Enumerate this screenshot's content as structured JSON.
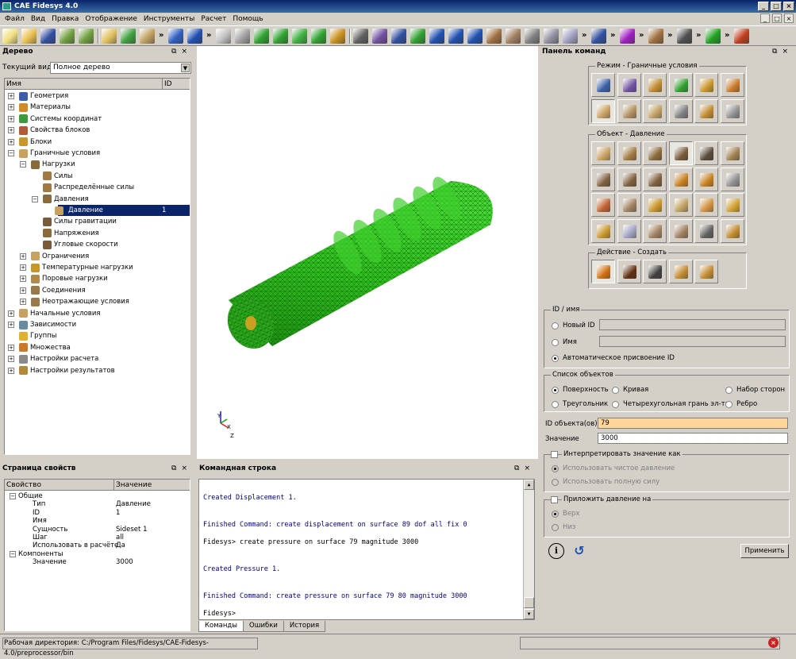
{
  "window": {
    "title": "CAE Fidesys 4.0",
    "min": "_",
    "max": "□",
    "close": "×"
  },
  "menu": [
    "Файл",
    "Вид",
    "Правка",
    "Отображение",
    "Инструменты",
    "Расчет",
    "Помощь"
  ],
  "tree_panel": {
    "title": "Дерево",
    "view_label": "Текущий вид",
    "view_value": "Полное дерево",
    "col_name": "Имя",
    "col_id": "ID",
    "selected_id": "1",
    "nodes": [
      {
        "label": "Геометрия",
        "level": 0,
        "exp": "+",
        "color": "#3a5fa8"
      },
      {
        "label": "Материалы",
        "level": 0,
        "exp": "+",
        "color": "#d08a2a"
      },
      {
        "label": "Системы координат",
        "level": 0,
        "exp": "+",
        "color": "#3c9a3c"
      },
      {
        "label": "Свойства блоков",
        "level": 0,
        "exp": "+",
        "color": "#b05a3a"
      },
      {
        "label": "Блоки",
        "level": 0,
        "exp": "+",
        "color": "#c8962a"
      },
      {
        "label": "Граничные условия",
        "level": 0,
        "exp": "-",
        "color": "#c8a060"
      },
      {
        "label": "Нагрузки",
        "level": 1,
        "exp": "-",
        "color": "#8a6a3a"
      },
      {
        "label": "Силы",
        "level": 2,
        "exp": "",
        "color": "#a07a40"
      },
      {
        "label": "Распределённые силы",
        "level": 2,
        "exp": "",
        "color": "#a07a40"
      },
      {
        "label": "Давления",
        "level": 2,
        "exp": "-",
        "color": "#8a6a3a"
      },
      {
        "label": "Давление",
        "level": 3,
        "exp": "",
        "color": "#c8a060",
        "selected": true
      },
      {
        "label": "Силы гравитации",
        "level": 2,
        "exp": "",
        "color": "#7a5a3a"
      },
      {
        "label": "Напряжения",
        "level": 2,
        "exp": "",
        "color": "#8a6a3a"
      },
      {
        "label": "Угловые скорости",
        "level": 2,
        "exp": "",
        "color": "#7a5a3a"
      },
      {
        "label": "Ограничения",
        "level": 1,
        "exp": "+",
        "color": "#c8a060"
      },
      {
        "label": "Температурные нагрузки",
        "level": 1,
        "exp": "+",
        "color": "#c8962a"
      },
      {
        "label": "Поровые нагрузки",
        "level": 1,
        "exp": "+",
        "color": "#b08a4a"
      },
      {
        "label": "Соединения",
        "level": 1,
        "exp": "+",
        "color": "#9a7a4a"
      },
      {
        "label": "Неотражающие условия",
        "level": 1,
        "exp": "+",
        "color": "#9a7a4a"
      },
      {
        "label": "Начальные условия",
        "level": 0,
        "exp": "+",
        "color": "#c8a060"
      },
      {
        "label": "Зависимости",
        "level": 0,
        "exp": "+",
        "color": "#6a8aa0"
      },
      {
        "label": "Группы",
        "level": 0,
        "exp": "",
        "color": "#e0b030"
      },
      {
        "label": "Множества",
        "level": 0,
        "exp": "+",
        "color": "#c87a2a"
      },
      {
        "label": "Настройки расчета",
        "level": 0,
        "exp": "+",
        "color": "#8a8a8a"
      },
      {
        "label": "Настройки результатов",
        "level": 0,
        "exp": "+",
        "color": "#b08a3a"
      }
    ]
  },
  "props_panel": {
    "title": "Страница свойств",
    "col_prop": "Свойство",
    "col_val": "Значение",
    "rows": [
      {
        "prop": "Общие",
        "val": "",
        "level": 0,
        "exp": "-"
      },
      {
        "prop": "Тип",
        "val": "Давление",
        "level": 1
      },
      {
        "prop": "ID",
        "val": "1",
        "level": 1
      },
      {
        "prop": "Имя",
        "val": "",
        "level": 1
      },
      {
        "prop": "Сущность",
        "val": "Sideset 1",
        "level": 1
      },
      {
        "prop": "Шаг",
        "val": "all",
        "level": 1
      },
      {
        "prop": "Использовать в расчёте",
        "val": "Да",
        "level": 1
      },
      {
        "prop": "Компоненты",
        "val": "",
        "level": 0,
        "exp": "-"
      },
      {
        "prop": "Значение",
        "val": "3000",
        "level": 1
      }
    ]
  },
  "viewport": {
    "axis_x": "X",
    "axis_y": "Y",
    "axis_z": "Z"
  },
  "cmd_panel": {
    "title": "Командная строка",
    "lines": [
      {
        "text": "Created Displacement 1.",
        "color": "blue"
      },
      {
        "text": "Finished Command: create displacement on surface 89 dof all fix 0",
        "color": "blue"
      },
      {
        "text": "Fidesys> create pressure on surface 79 magnitude 3000",
        "color": "black"
      },
      {
        "text": "Created Pressure 1.",
        "color": "blue"
      },
      {
        "text": "Finished Command: create pressure on surface 79 80 magnitude 3000",
        "color": "blue"
      },
      {
        "text": "Fidesys>",
        "color": "black"
      }
    ],
    "tabs": [
      "Команды",
      "Ошибки",
      "История"
    ]
  },
  "command_panel": {
    "title": "Панель команд",
    "mode_label": "Режим - Граничные условия",
    "object_label": "Объект - Давление",
    "action_label": "Действие - Создать",
    "id_group": "ID / имя",
    "new_id": "Новый ID",
    "name": "Имя",
    "auto_id": "Автоматическое присвоение ID",
    "objects_group": "Список объектов",
    "obj_surface": "Поверхность",
    "obj_curve": "Кривая",
    "obj_sideset": "Набор сторон",
    "obj_tri": "Треугольник",
    "obj_quad": "Четырехугольная грань эл-та",
    "obj_edge": "Ребро",
    "ids_label": "ID объекта(ов)",
    "ids_value": "79",
    "value_label": "Значение",
    "value_value": "3000",
    "interpret_label": "Интерпретировать значение как",
    "pure_pressure": "Использовать чистое давление",
    "full_force": "Использовать полную силу",
    "apply_on_label": "Приложить давление на",
    "top": "Верх",
    "bottom": "Низ",
    "apply_button": "Применить",
    "info_icon": "i"
  },
  "status": {
    "workdir": "Рабочая директория: C:/Program Files/Fidesys/CAE-Fidesys-4.0/preprocessor/bin"
  },
  "colors": {
    "mesh_green": "#2fbf1f",
    "selection": "#0a246a",
    "ids_field": "#ffd699"
  }
}
